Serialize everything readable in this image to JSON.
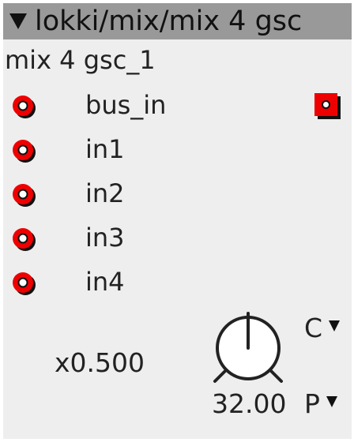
{
  "module": {
    "title": "lokki/mix/mix 4 gsc",
    "instance_name": "mix 4 gsc_1"
  },
  "inlets": [
    {
      "label": "bus_in"
    },
    {
      "label": "in1"
    },
    {
      "label": "in2"
    },
    {
      "label": "in3"
    },
    {
      "label": "in4"
    }
  ],
  "outlet": {
    "icon": "outlet-jack-icon"
  },
  "controls": {
    "gain_display": "x0.500",
    "knob_value": "32.00",
    "mode_c_label": "C",
    "mode_p_label": "P"
  },
  "colors": {
    "titlebar": "#999999",
    "panel": "#eeeeee",
    "jack_red": "#ee0000",
    "jack_shadow": "#111111"
  }
}
